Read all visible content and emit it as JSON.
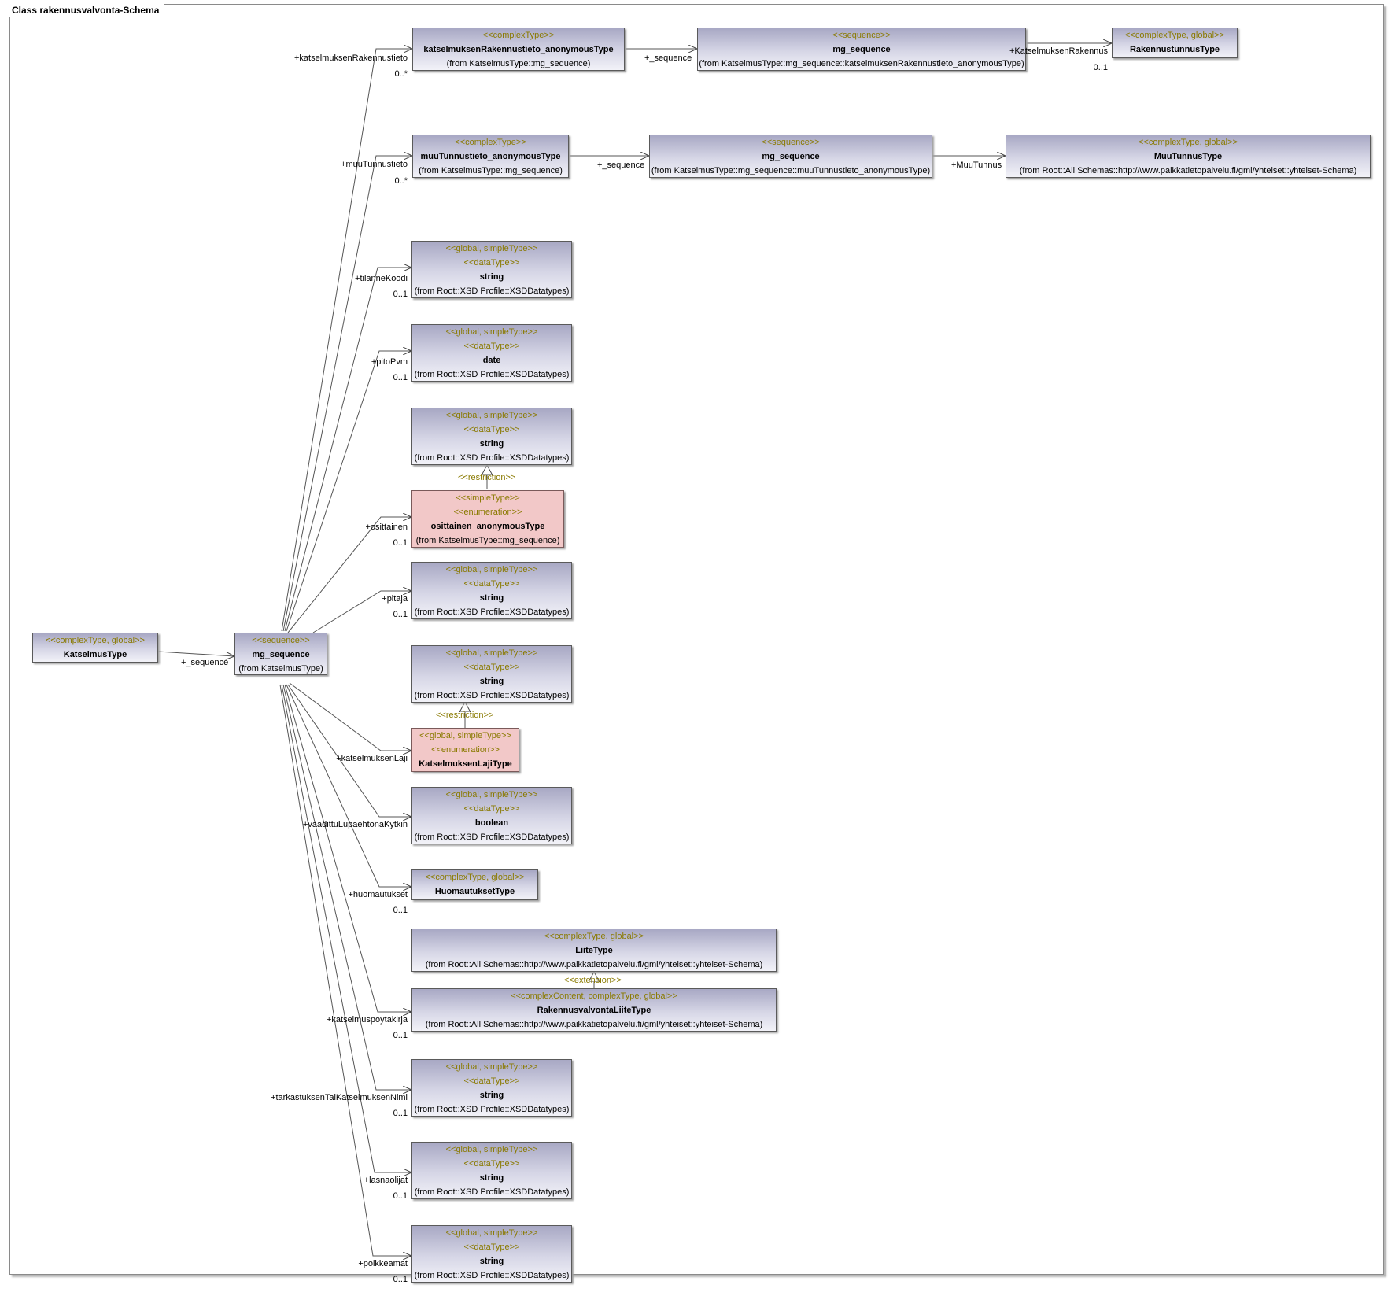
{
  "diagram_title": "Class rakennusvalvonta-Schema",
  "colors": {
    "stereotype": "#8a7a00",
    "box_gradient_top": "#a8a8c4",
    "box_pink": "#f2c8c8",
    "line": "#555555"
  },
  "boxes": [
    {
      "id": "katselmus-type",
      "lines": [
        {
          "t": "<<complexType, global>>",
          "k": "st"
        },
        {
          "t": "KatselmusType",
          "k": "nm"
        }
      ]
    },
    {
      "id": "mg-sequence-main",
      "lines": [
        {
          "t": "<<sequence>>",
          "k": "st"
        },
        {
          "t": "mg_sequence",
          "k": "nm"
        },
        {
          "t": "(from KatselmusType)",
          "k": "fr"
        }
      ]
    },
    {
      "id": "katselmuksen-rakennustieto-type",
      "lines": [
        {
          "t": "<<complexType>>",
          "k": "st"
        },
        {
          "t": "katselmuksenRakennustieto_anonymousType",
          "k": "nm"
        },
        {
          "t": "(from KatselmusType::mg_sequence)",
          "k": "fr"
        }
      ]
    },
    {
      "id": "mg-sequence-rakennustieto",
      "lines": [
        {
          "t": "<<sequence>>",
          "k": "st"
        },
        {
          "t": "mg_sequence",
          "k": "nm"
        },
        {
          "t": "(from KatselmusType::mg_sequence::katselmuksenRakennustieto_anonymousType)",
          "k": "fr"
        }
      ]
    },
    {
      "id": "rakennustunnus-type",
      "lines": [
        {
          "t": "<<complexType, global>>",
          "k": "st"
        },
        {
          "t": "RakennustunnusType",
          "k": "nm"
        }
      ]
    },
    {
      "id": "muu-tunnustieto-type",
      "lines": [
        {
          "t": "<<complexType>>",
          "k": "st"
        },
        {
          "t": "muuTunnustieto_anonymousType",
          "k": "nm"
        },
        {
          "t": "(from KatselmusType::mg_sequence)",
          "k": "fr"
        }
      ]
    },
    {
      "id": "mg-sequence-muutunnustieto",
      "lines": [
        {
          "t": "<<sequence>>",
          "k": "st"
        },
        {
          "t": "mg_sequence",
          "k": "nm"
        },
        {
          "t": "(from KatselmusType::mg_sequence::muuTunnustieto_anonymousType)",
          "k": "fr"
        }
      ]
    },
    {
      "id": "muu-tunnus-type",
      "lines": [
        {
          "t": "<<complexType, global>>",
          "k": "st"
        },
        {
          "t": "MuuTunnusType",
          "k": "nm"
        },
        {
          "t": "(from Root::All Schemas::http://www.paikkatietopalvelu.fi/gml/yhteiset::yhteiset-Schema)",
          "k": "fr"
        }
      ]
    },
    {
      "id": "string-tilannekoodi",
      "lines": [
        {
          "t": "<<global, simpleType>>",
          "k": "st"
        },
        {
          "t": "<<dataType>>",
          "k": "st"
        },
        {
          "t": "string",
          "k": "nm"
        },
        {
          "t": "(from Root::XSD Profile::XSDDatatypes)",
          "k": "fr"
        }
      ]
    },
    {
      "id": "date-pitopvm",
      "lines": [
        {
          "t": "<<global, simpleType>>",
          "k": "st"
        },
        {
          "t": "<<dataType>>",
          "k": "st"
        },
        {
          "t": "date",
          "k": "nm"
        },
        {
          "t": "(from Root::XSD Profile::XSDDatatypes)",
          "k": "fr"
        }
      ]
    },
    {
      "id": "string-restriction-base",
      "lines": [
        {
          "t": "<<global, simpleType>>",
          "k": "st"
        },
        {
          "t": "<<dataType>>",
          "k": "st"
        },
        {
          "t": "string",
          "k": "nm"
        },
        {
          "t": "(from Root::XSD Profile::XSDDatatypes)",
          "k": "fr"
        }
      ]
    },
    {
      "id": "osittainen-type",
      "pink": true,
      "lines": [
        {
          "t": "<<simpleType>>",
          "k": "st"
        },
        {
          "t": "<<enumeration>>",
          "k": "st"
        },
        {
          "t": "osittainen_anonymousType",
          "k": "nm"
        },
        {
          "t": "(from KatselmusType::mg_sequence)",
          "k": "fr"
        }
      ]
    },
    {
      "id": "string-pitaja",
      "lines": [
        {
          "t": "<<global, simpleType>>",
          "k": "st"
        },
        {
          "t": "<<dataType>>",
          "k": "st"
        },
        {
          "t": "string",
          "k": "nm"
        },
        {
          "t": "(from Root::XSD Profile::XSDDatatypes)",
          "k": "fr"
        }
      ]
    },
    {
      "id": "string-lajityyppi-base",
      "lines": [
        {
          "t": "<<global, simpleType>>",
          "k": "st"
        },
        {
          "t": "<<dataType>>",
          "k": "st"
        },
        {
          "t": "string",
          "k": "nm"
        },
        {
          "t": "(from Root::XSD Profile::XSDDatatypes)",
          "k": "fr"
        }
      ]
    },
    {
      "id": "katselmuksen-laji-type",
      "pink": true,
      "lines": [
        {
          "t": "<<global, simpleType>>",
          "k": "st"
        },
        {
          "t": "<<enumeration>>",
          "k": "st"
        },
        {
          "t": "KatselmuksenLajiType",
          "k": "nm"
        }
      ]
    },
    {
      "id": "boolean-vaadittu",
      "lines": [
        {
          "t": "<<global, simpleType>>",
          "k": "st"
        },
        {
          "t": "<<dataType>>",
          "k": "st"
        },
        {
          "t": "boolean",
          "k": "nm"
        },
        {
          "t": "(from Root::XSD Profile::XSDDatatypes)",
          "k": "fr"
        }
      ]
    },
    {
      "id": "huomautukset-type",
      "lines": [
        {
          "t": "<<complexType, global>>",
          "k": "st"
        },
        {
          "t": "HuomautuksetType",
          "k": "nm"
        }
      ]
    },
    {
      "id": "liite-type",
      "lines": [
        {
          "t": "<<complexType, global>>",
          "k": "st"
        },
        {
          "t": "LiiteType",
          "k": "nm"
        },
        {
          "t": "(from Root::All Schemas::http://www.paikkatietopalvelu.fi/gml/yhteiset::yhteiset-Schema)",
          "k": "fr"
        }
      ]
    },
    {
      "id": "rakennusvalvonta-liite-type",
      "lines": [
        {
          "t": "<<complexContent, complexType, global>>",
          "k": "st"
        },
        {
          "t": "RakennusvalvontaLiiteType",
          "k": "nm"
        },
        {
          "t": "(from Root::All Schemas::http://www.paikkatietopalvelu.fi/gml/yhteiset::yhteiset-Schema)",
          "k": "fr"
        }
      ]
    },
    {
      "id": "string-tarkastuksen-nimi",
      "lines": [
        {
          "t": "<<global, simpleType>>",
          "k": "st"
        },
        {
          "t": "<<dataType>>",
          "k": "st"
        },
        {
          "t": "string",
          "k": "nm"
        },
        {
          "t": "(from Root::XSD Profile::XSDDatatypes)",
          "k": "fr"
        }
      ]
    },
    {
      "id": "string-lasnaolijat",
      "lines": [
        {
          "t": "<<global, simpleType>>",
          "k": "st"
        },
        {
          "t": "<<dataType>>",
          "k": "st"
        },
        {
          "t": "string",
          "k": "nm"
        },
        {
          "t": "(from Root::XSD Profile::XSDDatatypes)",
          "k": "fr"
        }
      ]
    },
    {
      "id": "string-poikkeamat",
      "lines": [
        {
          "t": "<<global, simpleType>>",
          "k": "st"
        },
        {
          "t": "<<dataType>>",
          "k": "st"
        },
        {
          "t": "string",
          "k": "nm"
        },
        {
          "t": "(from Root::XSD Profile::XSDDatatypes)",
          "k": "fr"
        }
      ]
    }
  ],
  "labels": [
    {
      "id": "sequence-katselmus",
      "text": "+_sequence"
    },
    {
      "id": "role-katselmuksenrakennustieto",
      "text": "+katselmuksenRakennustieto"
    },
    {
      "id": "mult-katselmuksenrakennustieto",
      "text": "0..*"
    },
    {
      "id": "sequence-rakennustieto",
      "text": "+_sequence"
    },
    {
      "id": "role-katselmuksenrakennus",
      "text": "+KatselmuksenRakennus"
    },
    {
      "id": "mult-katselmuksenrakennus",
      "text": "0..1"
    },
    {
      "id": "role-muutunnustieto",
      "text": "+muuTunnustieto"
    },
    {
      "id": "mult-muutunnustieto",
      "text": "0..*"
    },
    {
      "id": "sequence-muutunnustieto",
      "text": "+_sequence"
    },
    {
      "id": "role-muutunnus",
      "text": "+MuuTunnus"
    },
    {
      "id": "role-tilannekoodi",
      "text": "+tilanneKoodi"
    },
    {
      "id": "mult-tilannekoodi",
      "text": "0..1"
    },
    {
      "id": "role-pitopvm",
      "text": "+pitoPvm"
    },
    {
      "id": "mult-pitopvm",
      "text": "0..1"
    },
    {
      "id": "restriction-osittainen",
      "text": "<<restriction>>"
    },
    {
      "id": "role-osittainen",
      "text": "+osittainen"
    },
    {
      "id": "mult-osittainen",
      "text": "0..1"
    },
    {
      "id": "role-pitaja",
      "text": "+pitaja"
    },
    {
      "id": "mult-pitaja",
      "text": "0..1"
    },
    {
      "id": "restriction-laji",
      "text": "<<restriction>>"
    },
    {
      "id": "role-katselmuksenlaji",
      "text": "+katselmuksenLaji"
    },
    {
      "id": "role-vaadittu",
      "text": "+vaadittuLupaehtonaKytkin"
    },
    {
      "id": "role-huomautukset",
      "text": "+huomautukset"
    },
    {
      "id": "mult-huomautukset",
      "text": "0..1"
    },
    {
      "id": "extension-liite",
      "text": "<<extension>>"
    },
    {
      "id": "role-katselmuspoytakirja",
      "text": "+katselmuspoytakirja"
    },
    {
      "id": "mult-katselmuspoytakirja",
      "text": "0..1"
    },
    {
      "id": "role-tarkastuksennimi",
      "text": "+tarkastuksenTaiKatselmuksenNimi"
    },
    {
      "id": "mult-tarkastuksennimi",
      "text": "0..1"
    },
    {
      "id": "role-lasnaolijat",
      "text": "+lasnaolijat"
    },
    {
      "id": "mult-lasnaolijat",
      "text": "0..1"
    },
    {
      "id": "role-poikkeamat",
      "text": "+poikkeamat"
    },
    {
      "id": "mult-poikkeamat",
      "text": "0..1"
    }
  ]
}
